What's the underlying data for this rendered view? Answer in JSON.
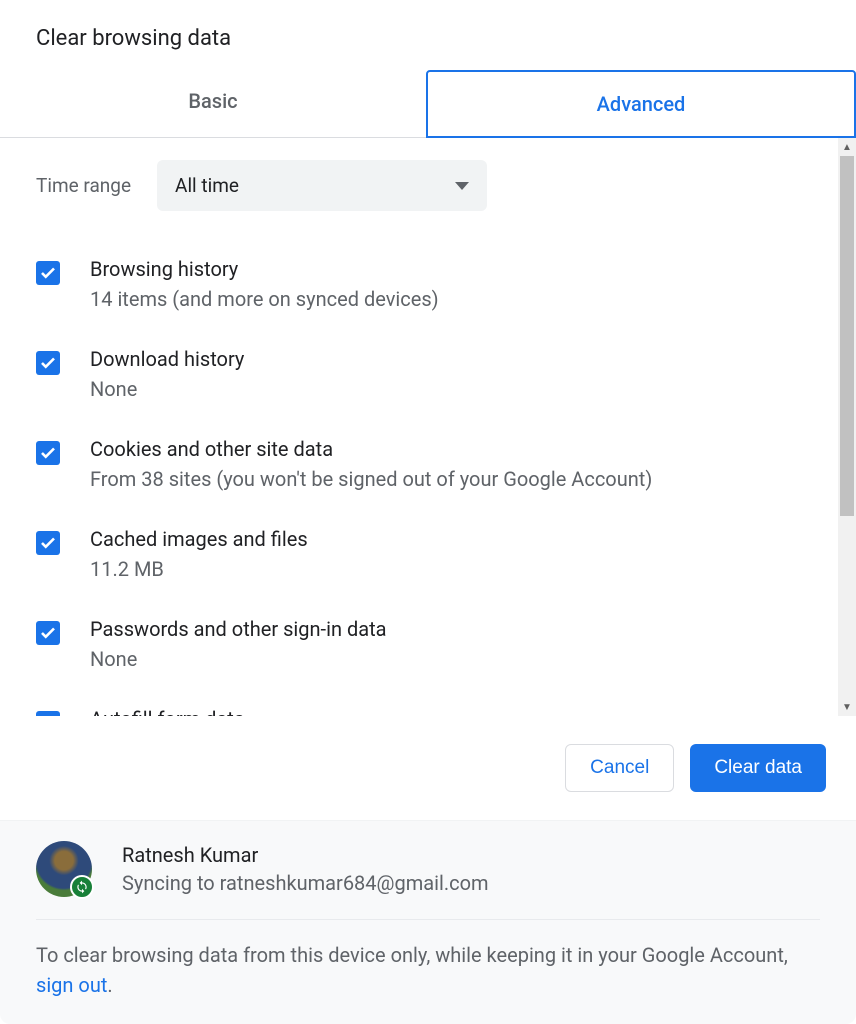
{
  "title": "Clear browsing data",
  "tabs": {
    "basic": "Basic",
    "advanced": "Advanced"
  },
  "timeRange": {
    "label": "Time range",
    "value": "All time"
  },
  "items": [
    {
      "title": "Browsing history",
      "sub": "14 items (and more on synced devices)"
    },
    {
      "title": "Download history",
      "sub": "None"
    },
    {
      "title": "Cookies and other site data",
      "sub": "From 38 sites (you won't be signed out of your Google Account)"
    },
    {
      "title": "Cached images and files",
      "sub": "11.2 MB"
    },
    {
      "title": "Passwords and other sign-in data",
      "sub": "None"
    },
    {
      "title": "Autofill form data"
    }
  ],
  "buttons": {
    "cancel": "Cancel",
    "clear": "Clear data"
  },
  "account": {
    "name": "Ratnesh Kumar",
    "sync": "Syncing to ratneshkumar684@gmail.com",
    "noticePrefix": "To clear browsing data from this device only, while keeping it in your Google Account, ",
    "signOut": "sign out",
    "noticeSuffix": "."
  }
}
